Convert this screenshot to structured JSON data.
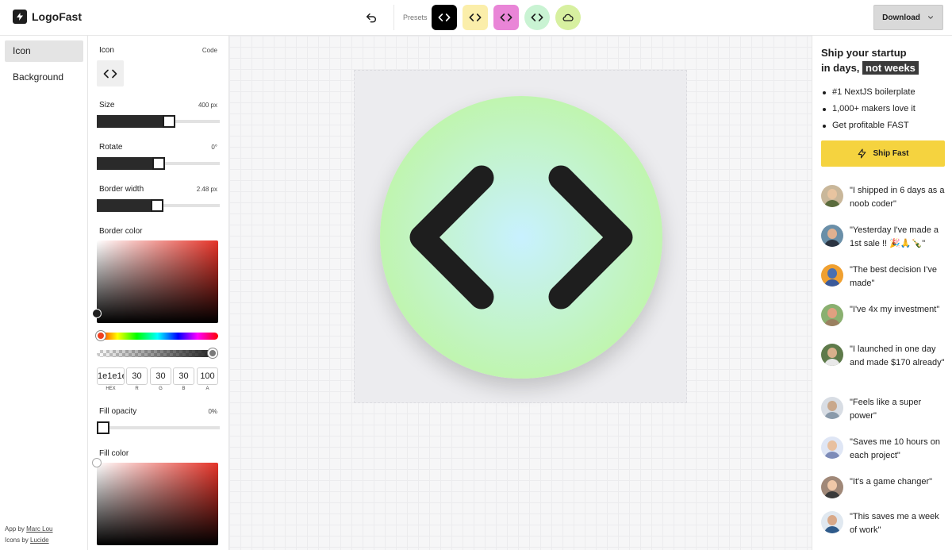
{
  "app": {
    "name": "LogoFast"
  },
  "toolbar": {
    "undo_icon": "undo-icon",
    "presets_label": "Presets",
    "presets": [
      {
        "bg": "#000000",
        "fg": "#ffffff"
      },
      {
        "bg": "#fbeeaa",
        "fg": "#1e1e1e"
      },
      {
        "bg": "#e985d7",
        "fg": "#1e1e1e"
      },
      {
        "bg": "#c9f3d3",
        "fg": "#1e1e1e"
      },
      {
        "bg": "#d7f0a0",
        "fg": "#1e1e1e"
      }
    ],
    "download_label": "Download"
  },
  "nav": {
    "items": [
      {
        "label": "Icon",
        "active": true
      },
      {
        "label": "Background",
        "active": false
      }
    ],
    "credits": [
      {
        "prefix": "App by ",
        "link": "Marc Lou"
      },
      {
        "prefix": "Icons by ",
        "link": "Lucide"
      }
    ]
  },
  "settings": {
    "icon_label": "Icon",
    "icon_name": "Code",
    "size": {
      "label": "Size",
      "value_text": "400 px",
      "fraction": 0.6
    },
    "rotate": {
      "label": "Rotate",
      "value_text": "0°",
      "fraction": 0.5
    },
    "border_width": {
      "label": "Border width",
      "value_text": "2.48 px",
      "fraction": 0.49
    },
    "border_color": {
      "label": "Border color",
      "hex": "1e1e1e",
      "r": "30",
      "g": "30",
      "b": "30",
      "a": "100",
      "field_labels": [
        "HEX",
        "R",
        "G",
        "B",
        "A"
      ]
    },
    "fill_opacity": {
      "label": "Fill opacity",
      "value_text": "0%",
      "fraction": 0
    },
    "fill_color": {
      "label": "Fill color"
    }
  },
  "canvas": {
    "icon": "code-icon",
    "colors": {
      "stroke": "#1e1e1e",
      "fill_center": "#c8f1ff",
      "fill_edge": "#bff79a"
    }
  },
  "promo": {
    "title_line1": "Ship your startup",
    "title_line2_prefix": "in days,",
    "title_highlight": "not weeks",
    "bullets": [
      "#1 NextJS boilerplate",
      "1,000+ makers love it",
      "Get profitable FAST"
    ],
    "cta": "Ship Fast",
    "testimonials": [
      "\"I shipped in 6 days as a noob coder\"",
      "\"Yesterday I've made a 1st sale !! 🎉🙏🍾\"",
      "\"The best decision I've made\"",
      "\"I've 4x my investment\"",
      "\"I launched in one day and made $170 already\"",
      "\"Feels like a super power\"",
      "\"Saves me 10 hours on each project\"",
      "\"It's a game changer\"",
      "\"This saves me a week of work\""
    ]
  }
}
